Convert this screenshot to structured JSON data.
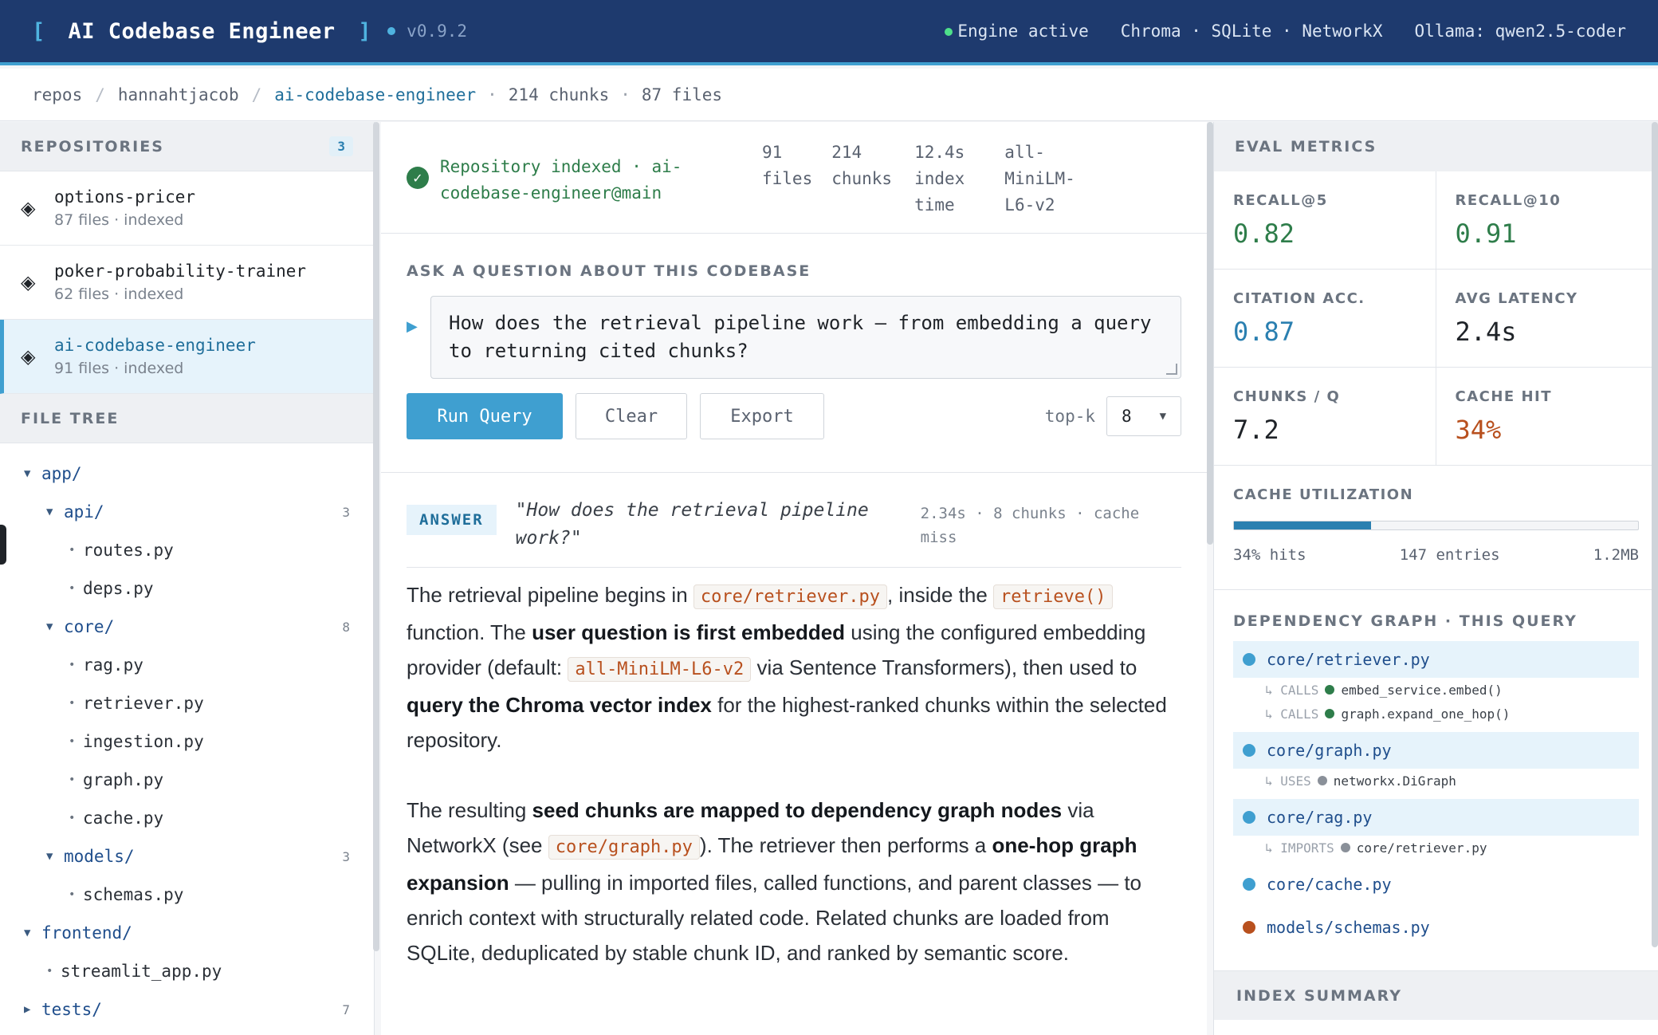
{
  "header": {
    "bracket_open": "[",
    "title": "AI Codebase Engineer",
    "bracket_close": "]",
    "version": "v0.9.2",
    "engine_status": "Engine active",
    "stack": "Chroma · SQLite · NetworkX",
    "model": "Ollama: qwen2.5-coder",
    "colors": {
      "header_bg": "#1e3a6e",
      "accent": "#3f9fd0",
      "engine_ok": "#4ee08a"
    }
  },
  "breadcrumb": {
    "root": "repos",
    "owner": "hannahtjacob",
    "repo": "ai-codebase-engineer",
    "chunks": "214 chunks",
    "files": "87 files"
  },
  "sidebar": {
    "repositories_label": "REPOSITORIES",
    "repositories_count": "3",
    "repos": [
      {
        "name": "options-pricer",
        "meta": "87 files · indexed",
        "icon": "diamond-icon"
      },
      {
        "name": "poker-probability-trainer",
        "meta": "62 files · indexed",
        "icon": "diamond-icon"
      },
      {
        "name": "ai-codebase-engineer",
        "meta": "91 files · indexed",
        "icon": "diamond-icon",
        "active": true
      }
    ],
    "file_tree_label": "FILE TREE",
    "tree": [
      {
        "name": "app/",
        "type": "dir",
        "open": true,
        "count": ""
      },
      {
        "name": "api/",
        "type": "dir",
        "open": true,
        "count": "3"
      },
      {
        "name": "routes.py",
        "type": "file"
      },
      {
        "name": "deps.py",
        "type": "file"
      },
      {
        "name": "core/",
        "type": "dir",
        "open": true,
        "count": "8"
      },
      {
        "name": "rag.py",
        "type": "file"
      },
      {
        "name": "retriever.py",
        "type": "file"
      },
      {
        "name": "ingestion.py",
        "type": "file"
      },
      {
        "name": "graph.py",
        "type": "file"
      },
      {
        "name": "cache.py",
        "type": "file"
      },
      {
        "name": "models/",
        "type": "dir",
        "open": true,
        "count": "3"
      },
      {
        "name": "schemas.py",
        "type": "file"
      },
      {
        "name": "frontend/",
        "type": "dir",
        "open": true,
        "count": ""
      },
      {
        "name": "streamlit_app.py",
        "type": "file"
      },
      {
        "name": "tests/",
        "type": "dir",
        "open": false,
        "count": "7"
      }
    ]
  },
  "status": {
    "message": "Repository indexed · ai-codebase-engineer@main",
    "files_value": "91",
    "files_label": "files",
    "chunks_value": "214",
    "chunks_label": "chunks",
    "time_value": "12.4s",
    "time_label_1": "index",
    "time_label_2": "time",
    "model_line_1": "all-",
    "model_line_2": "MiniLM-",
    "model_line_3": "L6-v2"
  },
  "ask": {
    "label": "ASK A QUESTION ABOUT THIS CODEBASE",
    "question": "How does the retrieval pipeline work — from embedding a query to returning cited chunks?",
    "run_label": "Run Query",
    "clear_label": "Clear",
    "export_label": "Export",
    "topk_label": "top-k",
    "topk_value": "8"
  },
  "answer": {
    "badge": "ANSWER",
    "question": "\"How does the retrieval pipeline work?\"",
    "meta": "2.34s · 8 chunks · cache miss",
    "p1": {
      "t1": "The retrieval pipeline begins in ",
      "c1": "core/retriever.py",
      "t2": ", inside the ",
      "c2": "retrieve()",
      "t3": " function. The ",
      "b1": "user question is first embedded",
      "t4": " using the configured embedding provider (default: ",
      "c3": "all-MiniLM-L6-v2",
      "t5": " via Sentence Transformers), then used to ",
      "b2": "query the Chroma vector index",
      "t6": " for the highest-ranked chunks within the selected repository."
    },
    "p2": {
      "t1": "The resulting ",
      "b1": "seed chunks are mapped to dependency graph nodes",
      "t2": " via NetworkX (see ",
      "c1": "core/graph.py",
      "t3": "). The retriever then performs a ",
      "b2": "one-hop graph expansion",
      "t4": " — pulling in imported files, called functions, and parent classes — to enrich context with structurally related code. Related chunks are loaded from SQLite, deduplicated by stable chunk ID, and ranked by semantic score."
    }
  },
  "metrics": {
    "title": "EVAL METRICS",
    "items": [
      {
        "label": "RECALL@5",
        "value": "0.82",
        "color": "#2e7d4a"
      },
      {
        "label": "RECALL@10",
        "value": "0.91",
        "color": "#2e7d4a"
      },
      {
        "label": "CITATION ACC.",
        "value": "0.87",
        "color": "#2a7fb0"
      },
      {
        "label": "AVG LATENCY",
        "value": "2.4s",
        "color": "#1f2328"
      },
      {
        "label": "CHUNKS / Q",
        "value": "7.2",
        "color": "#1f2328"
      },
      {
        "label": "CACHE HIT",
        "value": "34%",
        "color": "#b8501e"
      }
    ]
  },
  "cache": {
    "title": "CACHE UTILIZATION",
    "fill_fraction": 0.34,
    "hits": "34% hits",
    "entries": "147 entries",
    "size": "1.2MB"
  },
  "dependency": {
    "title": "DEPENDENCY GRAPH · THIS QUERY",
    "nodes": [
      {
        "name": "core/retriever.py",
        "color": "#3f9fd0",
        "highlight": true,
        "edges": [
          {
            "rel": "↳ CALLS",
            "target": "embed_service.embed()",
            "color": "#2e7d4a"
          },
          {
            "rel": "↳ CALLS",
            "target": "graph.expand_one_hop()",
            "color": "#2e7d4a"
          }
        ]
      },
      {
        "name": "core/graph.py",
        "color": "#3f9fd0",
        "highlight": true,
        "edges": [
          {
            "rel": "↳ USES",
            "target": "networkx.DiGraph",
            "color": "#8a9099"
          }
        ]
      },
      {
        "name": "core/rag.py",
        "color": "#3f9fd0",
        "highlight": true,
        "edges": [
          {
            "rel": "↳ IMPORTS",
            "target": "core/retriever.py",
            "color": "#8a9099"
          }
        ]
      },
      {
        "name": "core/cache.py",
        "color": "#3f9fd0",
        "highlight": false,
        "edges": []
      },
      {
        "name": "models/schemas.py",
        "color": "#b8501e",
        "highlight": false,
        "edges": []
      }
    ]
  },
  "index_summary": {
    "title": "INDEX SUMMARY"
  }
}
